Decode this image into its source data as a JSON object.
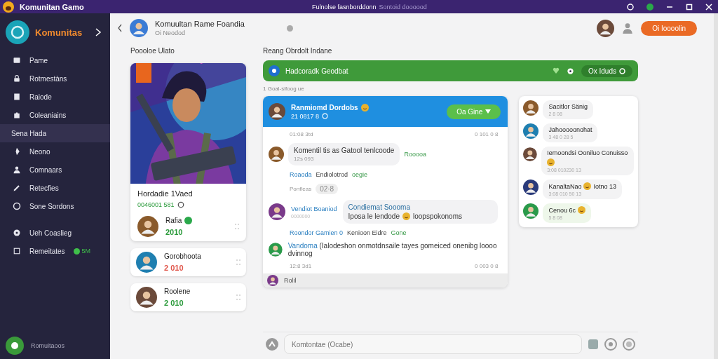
{
  "window": {
    "title": "Komunitan Gamo",
    "center_title": "Fulnolse fasnborddonn",
    "center_subtitle": "Sontoid doooood"
  },
  "sidebar": {
    "header": "Komunitas",
    "items": [
      {
        "kind": "item",
        "label": "Pame"
      },
      {
        "kind": "item",
        "label": "Rotmestàns"
      },
      {
        "kind": "item",
        "label": "Raiode"
      },
      {
        "kind": "item",
        "label": "Coleaniains"
      },
      {
        "kind": "section",
        "label": "Sena Hada"
      },
      {
        "kind": "item",
        "label": "Neono"
      },
      {
        "kind": "item",
        "label": "Comnaars"
      },
      {
        "kind": "item",
        "label": "Retecfies"
      },
      {
        "kind": "item",
        "label": "Sone Sordons"
      },
      {
        "kind": "item",
        "label": "Ueh Coaslieg"
      },
      {
        "kind": "item",
        "label": "Remeitates",
        "badge": "5M"
      }
    ],
    "footer": "Romuitaoos"
  },
  "header": {
    "title": "Komuultan Rame Foandia",
    "subtitle": "Oi Neodod",
    "button": "Oi Ioooolin"
  },
  "profile": {
    "heading": "Poooloe Ulato",
    "name": "Hordadie 1Vaed",
    "stat": "0046001 581",
    "members": [
      {
        "name": "Rafia",
        "score": "2010",
        "online": true,
        "color": "#2a9a3a"
      },
      {
        "name": "Gorobhoota",
        "score": "2 010",
        "online": false,
        "color": "#e0554a"
      },
      {
        "name": "Roolene",
        "score": "2 010",
        "online": false,
        "color": "#2a9a3a"
      }
    ]
  },
  "room": {
    "heading": "Reang Obrdolt Indane",
    "banner": "Hadcoradk Geodbat",
    "banner_pill": "Ox Iduds",
    "note": "1 Goal-sifoog ue",
    "chat": {
      "title": "Ranmiomd Dordobs",
      "subtitle": "21 0817 8",
      "menu": "Oa Gine",
      "top_time": "01:08 3td",
      "top_stats": "0 101 0 8",
      "bottom_time": "12:8 3d1",
      "bottom_stats": "0 003 0 8",
      "footer_name": "Rolil",
      "messages": [
        {
          "kind": "bubble",
          "text": "Komentil tis as Gatool tenlcoode",
          "time": "12s 093",
          "tag": "Rooooa"
        },
        {
          "kind": "reply",
          "parts": [
            "Roaoda",
            "Endiolotrod",
            "oegie"
          ]
        },
        {
          "kind": "meta",
          "text": "Ponfleas",
          "chip": "02·8"
        },
        {
          "kind": "quote",
          "author": "Vendiot Boaniod",
          "time": "0000000",
          "title": "Condiemat Soooma",
          "text": "Iposa le lendode",
          "text2": "loopspokonoms"
        },
        {
          "kind": "reply",
          "parts": [
            "Roondor Gamien 0",
            "Kenioon Eidre",
            "Gone"
          ]
        },
        {
          "kind": "plain",
          "author": "Vandoma",
          "text": "(Ialodeshon onmotdnsaile tayes gomeiced onenibg loooo dvinnog"
        }
      ]
    }
  },
  "contacts": [
    {
      "name": "Sacitlor Sänig",
      "time": "2 8 08",
      "emoji": false
    },
    {
      "name": "Jahooooonohat",
      "time": "3 48 0 28 5",
      "emoji": false
    },
    {
      "name": "Iemoondsi Ooniluo Conuisso",
      "time": "3:08 010230 13",
      "emoji": true
    },
    {
      "name": "KanaltaNao",
      "extra": "Iotno 13",
      "time": "3:08 010 50 13",
      "emoji": true
    },
    {
      "name": "Cenou 6c",
      "time": "5 8 08",
      "emoji": true
    }
  ],
  "composer": {
    "placeholder": "Komtontae (Ocabe)"
  }
}
